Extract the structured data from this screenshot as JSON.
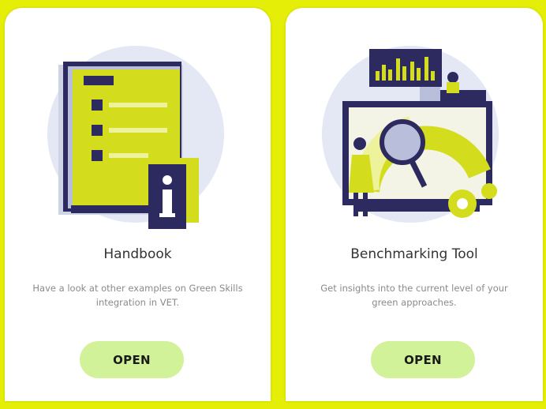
{
  "colors": {
    "accent": "#e4ee06",
    "button_bg": "#d2f29a",
    "navy": "#2c2a5e"
  },
  "cards": [
    {
      "title": "Handbook",
      "description": "Have a look at other examples on Green Skills integration in VET.",
      "button_label": "OPEN",
      "icon": "handbook-illustration"
    },
    {
      "title": "Benchmarking Tool",
      "description": "Get insights into the current level of your green approaches.",
      "button_label": "OPEN",
      "icon": "benchmark-gauge-illustration"
    }
  ]
}
